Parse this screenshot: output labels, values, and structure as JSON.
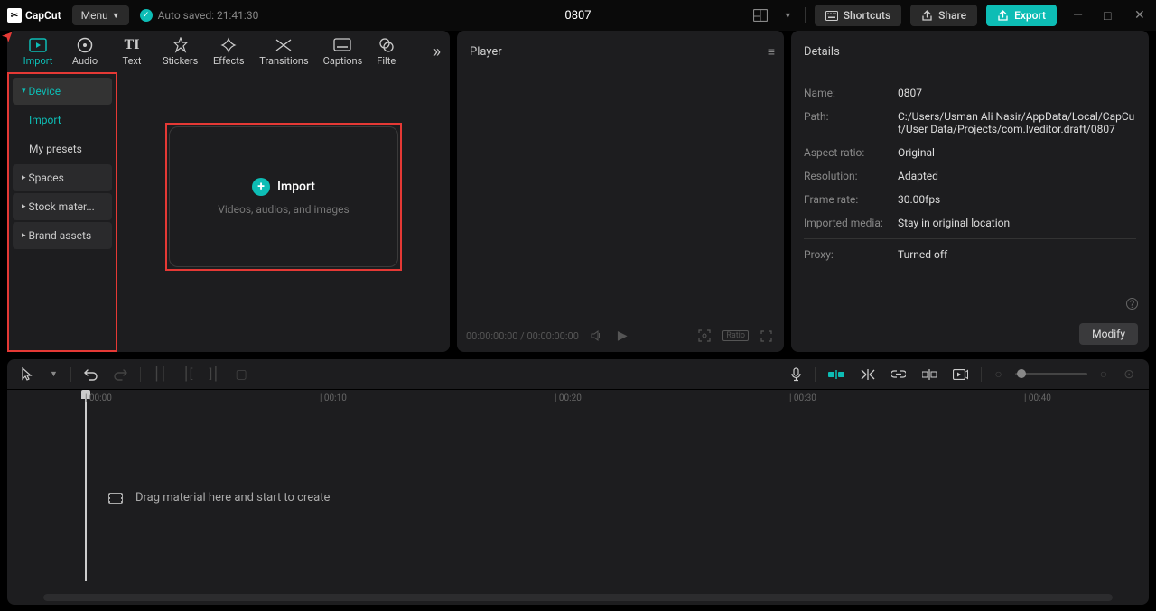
{
  "titlebar": {
    "logo_text": "CapCut",
    "menu_label": "Menu",
    "autosave_text": "Auto saved: 21:41:30",
    "project_title": "0807",
    "shortcuts_label": "Shortcuts",
    "share_label": "Share",
    "export_label": "Export"
  },
  "main_tabs": [
    {
      "label": "Import",
      "icon": "▸"
    },
    {
      "label": "Audio",
      "icon": "◯"
    },
    {
      "label": "Text",
      "icon": "T"
    },
    {
      "label": "Stickers",
      "icon": "✦"
    },
    {
      "label": "Effects",
      "icon": "✧"
    },
    {
      "label": "Transitions",
      "icon": "⋈"
    },
    {
      "label": "Captions",
      "icon": "▭"
    },
    {
      "label": "Filte",
      "icon": "◧"
    }
  ],
  "sidebar": {
    "items": [
      {
        "label": "Device",
        "kind": "group-open"
      },
      {
        "label": "Import",
        "kind": "sub-active"
      },
      {
        "label": "My presets",
        "kind": "sub"
      },
      {
        "label": "Spaces",
        "kind": "group"
      },
      {
        "label": "Stock mater...",
        "kind": "group"
      },
      {
        "label": "Brand assets",
        "kind": "group"
      }
    ]
  },
  "import_box": {
    "title": "Import",
    "subtitle": "Videos, audios, and images"
  },
  "player": {
    "title": "Player",
    "time": "00:00:00:00 / 00:00:00:00",
    "ratio_label": "Ratio"
  },
  "details": {
    "title": "Details",
    "rows": [
      {
        "label": "Name:",
        "value": "0807"
      },
      {
        "label": "Path:",
        "value": "C:/Users/Usman Ali Nasir/AppData/Local/CapCut/User Data/Projects/com.lveditor.draft/0807"
      },
      {
        "label": "Aspect ratio:",
        "value": "Original"
      },
      {
        "label": "Resolution:",
        "value": "Adapted"
      },
      {
        "label": "Frame rate:",
        "value": "30.00fps"
      },
      {
        "label": "Imported media:",
        "value": "Stay in original location"
      },
      {
        "label": "Proxy:",
        "value": "Turned off"
      }
    ],
    "modify_label": "Modify"
  },
  "timeline": {
    "ruler": [
      {
        "pos": 86,
        "label": "00:00"
      },
      {
        "pos": 346,
        "label": "00:10"
      },
      {
        "pos": 606,
        "label": "00:20"
      },
      {
        "pos": 866,
        "label": "00:30"
      },
      {
        "pos": 1126,
        "label": "00:40"
      }
    ],
    "drag_hint": "Drag material here and start to create"
  }
}
